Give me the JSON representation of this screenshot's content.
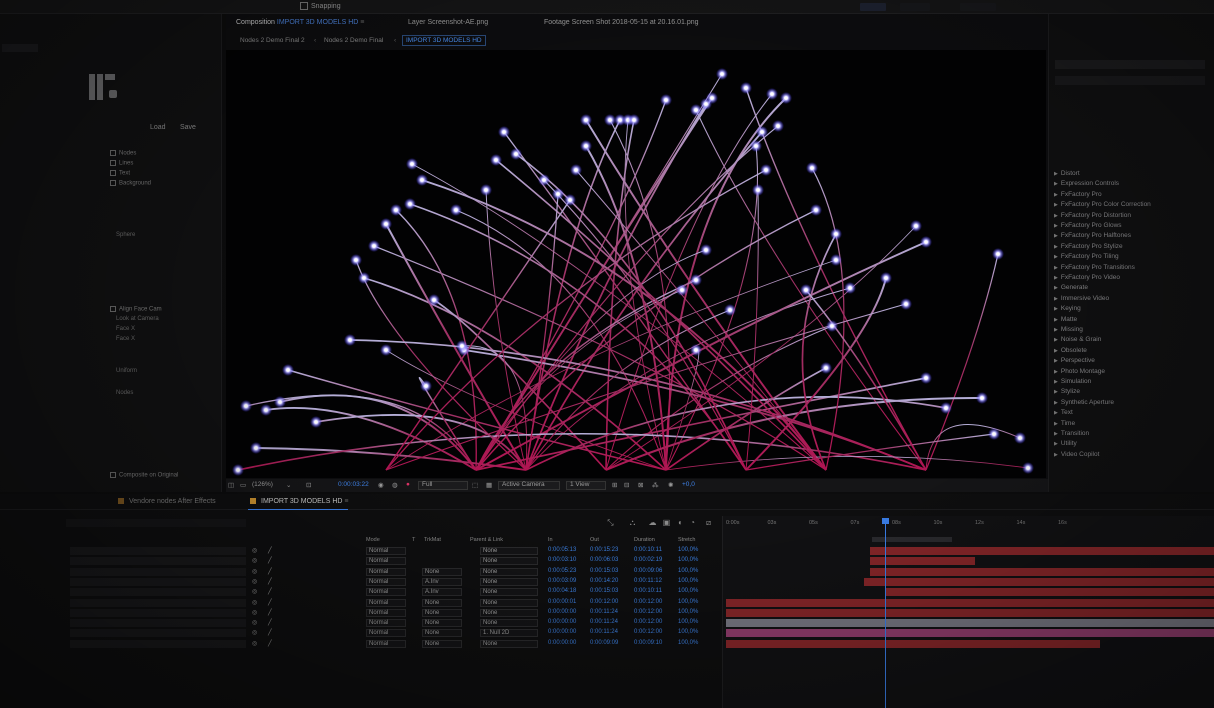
{
  "topbar": {
    "snapping_label": "Snapping"
  },
  "left_panel": {
    "load_label": "Load",
    "save_label": "Save",
    "checkboxes": [
      {
        "label": "Nodes",
        "checked": true
      },
      {
        "label": "Lines",
        "checked": false
      },
      {
        "label": "Text",
        "checked": false
      },
      {
        "label": "Background",
        "checked": false
      }
    ],
    "dropdowns": [
      {
        "value": "Sphere"
      },
      {
        "value": "Look at Camera"
      },
      {
        "value": "Face X"
      },
      {
        "value": "Face X"
      },
      {
        "value": "Uniform"
      },
      {
        "value": "Nodes"
      }
    ],
    "face_cam_label": "Align Face Cam",
    "composite_label": "Composite on Original"
  },
  "comp": {
    "tabs": [
      {
        "prefix": "Composition",
        "name": "IMPORT 3D MODELS HD",
        "active": true
      },
      {
        "prefix": "",
        "name": "Layer Screenshot-AE.png",
        "active": false
      },
      {
        "prefix": "",
        "name": "Footage Screen Shot 2018-05-15 at 20.16.01.png",
        "active": false
      }
    ],
    "breadcrumbs": [
      "Nodes 2 Demo Final 2",
      "Nodes 2 Demo Final",
      "IMPORT 3D MODELS HD"
    ],
    "viewer_bar": {
      "zoom": "(126%)",
      "timecode": "0:00:03:22",
      "resolution": "Full",
      "camera": "Active Camera",
      "views": "1 View",
      "exposure": "+0,0"
    }
  },
  "effects_panel": {
    "items": [
      "Distort",
      "Expression Controls",
      "FxFactory Pro",
      "FxFactory Pro Color Correction",
      "FxFactory Pro Distortion",
      "FxFactory Pro Glows",
      "FxFactory Pro Halftones",
      "FxFactory Pro Stylize",
      "FxFactory Pro Tiling",
      "FxFactory Pro Transitions",
      "FxFactory Pro Video",
      "Generate",
      "Immersive Video",
      "Keying",
      "Matte",
      "Missing",
      "Noise & Grain",
      "Obsolete",
      "Perspective",
      "Photo Montage",
      "Simulation",
      "Stylize",
      "Synthetic Aperture",
      "Text",
      "Time",
      "Transition",
      "Utility",
      "Video Copilot"
    ]
  },
  "timeline": {
    "tabs": [
      {
        "label": "Vendore nodes After Effects",
        "active": false
      },
      {
        "label": "IMPORT 3D MODELS HD",
        "active": true
      }
    ],
    "headers": {
      "mode": "Mode",
      "t": "T",
      "trkmat": "TrkMat",
      "parent": "Parent & Link",
      "in": "In",
      "out": "Out",
      "duration": "Duration",
      "stretch": "Stretch"
    },
    "rows": [
      {
        "mode": "Normal",
        "trkmat": "",
        "parent": "None",
        "in": "0:00:05:13",
        "out": "0:00:15:23",
        "duration": "0:00:10:11",
        "stretch": "100,0%"
      },
      {
        "mode": "Normal",
        "trkmat": "",
        "parent": "None",
        "in": "0:00:03:10",
        "out": "0:00:06:03",
        "duration": "0:00:02:19",
        "stretch": "100,0%"
      },
      {
        "mode": "Normal",
        "trkmat": "None",
        "parent": "None",
        "in": "0:00:05:23",
        "out": "0:00:15:03",
        "duration": "0:00:09:06",
        "stretch": "100,0%"
      },
      {
        "mode": "Normal",
        "trkmat": "A.Inv",
        "parent": "None",
        "in": "0:00:03:09",
        "out": "0:00:14:20",
        "duration": "0:00:11:12",
        "stretch": "100,0%"
      },
      {
        "mode": "Normal",
        "trkmat": "A.Inv",
        "parent": "None",
        "in": "0:00:04:18",
        "out": "0:00:15:03",
        "duration": "0:00:10:11",
        "stretch": "100,0%"
      },
      {
        "mode": "Normal",
        "trkmat": "None",
        "parent": "None",
        "in": "0:00:00:01",
        "out": "0:00:12:00",
        "duration": "0:00:12:00",
        "stretch": "100,0%"
      },
      {
        "mode": "Normal",
        "trkmat": "None",
        "parent": "None",
        "in": "0:00:00:00",
        "out": "0:00:11:24",
        "duration": "0:00:12:00",
        "stretch": "100,0%"
      },
      {
        "mode": "Normal",
        "trkmat": "None",
        "parent": "None",
        "in": "0:00:00:00",
        "out": "0:00:11:24",
        "duration": "0:00:12:00",
        "stretch": "100,0%"
      },
      {
        "mode": "Normal",
        "trkmat": "None",
        "parent": "1. Null 2D",
        "in": "0:00:00:00",
        "out": "0:00:11:24",
        "duration": "0:00:12:00",
        "stretch": "100,0%"
      },
      {
        "mode": "Normal",
        "trkmat": "None",
        "parent": "None",
        "in": "0:00:00:00",
        "out": "0:00:09:09",
        "duration": "0:00:09:10",
        "stretch": "100,0%"
      }
    ],
    "ruler_ticks": [
      "0:00s",
      "03s",
      "05s",
      "07s",
      "08s",
      "10s",
      "12s",
      "14s",
      "16s"
    ],
    "colors": {
      "accent_blue": "#3a7ee8",
      "bar_red": "#9b2a2e",
      "bar_pink": "#a8457e",
      "label_orange": "#c8902f"
    }
  }
}
